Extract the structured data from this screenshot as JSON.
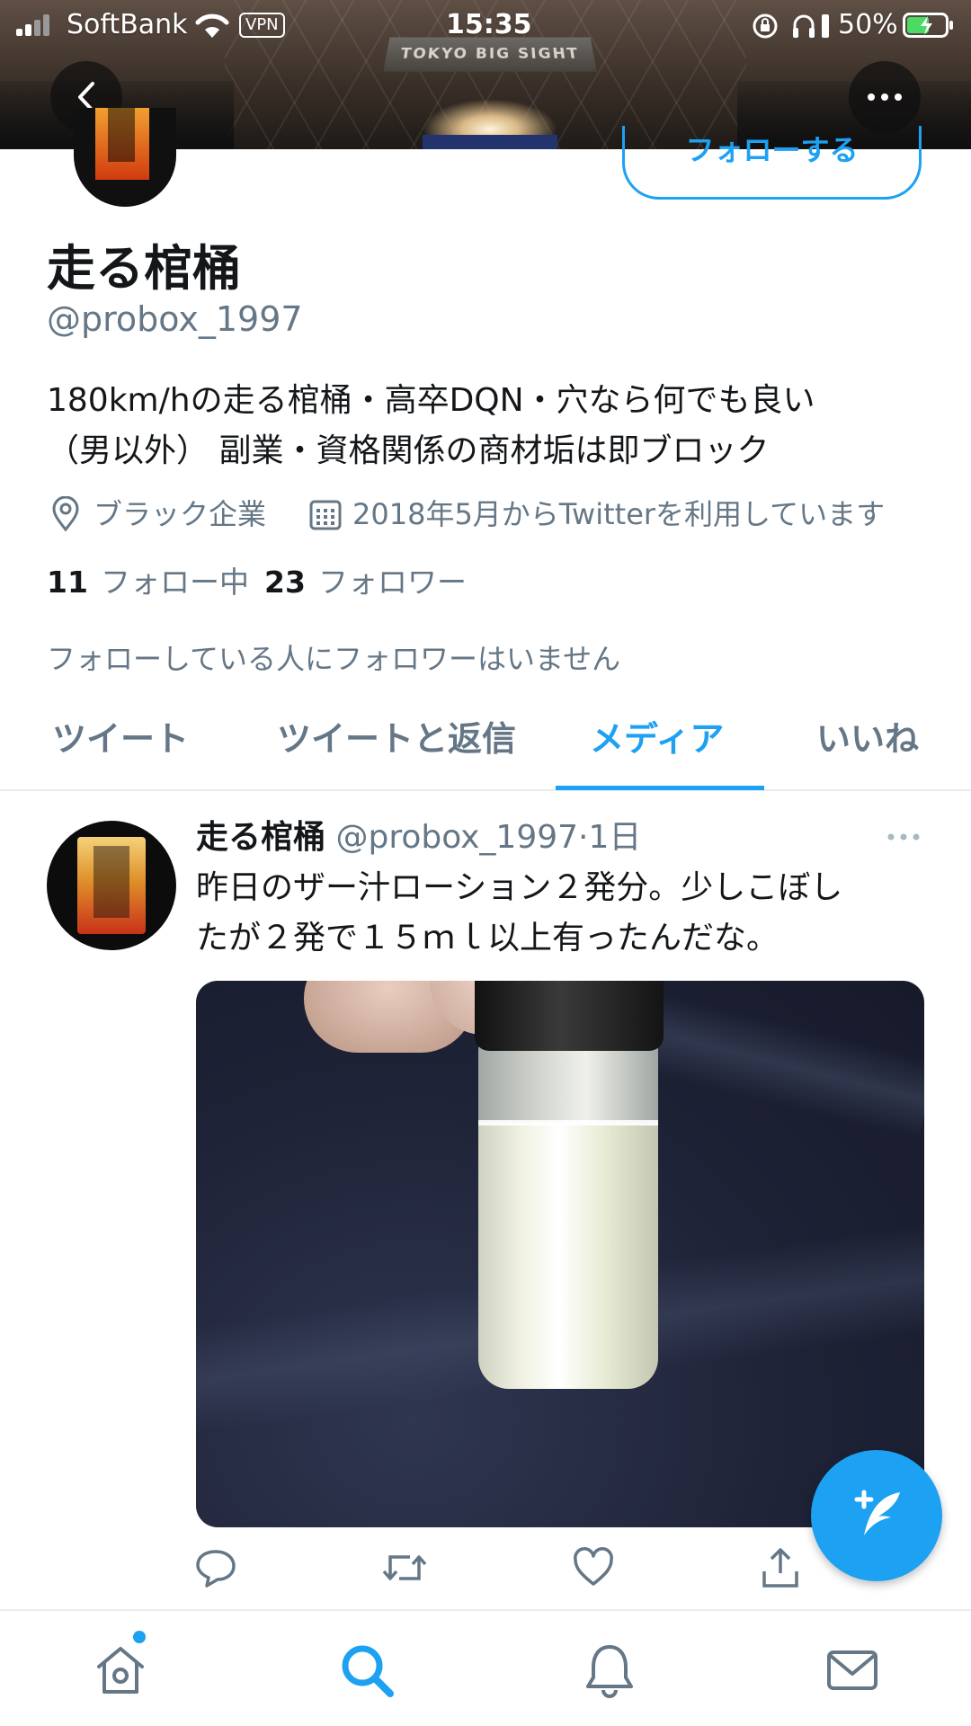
{
  "status_bar": {
    "carrier": "SoftBank",
    "vpn": "VPN",
    "time": "15:35",
    "battery": "50%"
  },
  "banner": {
    "sign_text": "TOKYO BIG SIGHT"
  },
  "profile": {
    "follow_button": "フォローする",
    "name": "走る棺桶",
    "handle": "@probox_1997",
    "bio_line1": "180km/hの走る棺桶・高卒DQN・穴なら何でも良い",
    "bio_line2": "（男以外） 副業・資格関係の商材垢は即ブロック",
    "location": "ブラック企業",
    "joined": "2018年5月からTwitterを利用しています",
    "following_count": "11",
    "following_label": "フォロー中",
    "followers_count": "23",
    "followers_label": "フォロワー",
    "no_followers_note": "フォローしている人にフォロワーはいません"
  },
  "tabs": [
    {
      "label": "ツイート",
      "active": false
    },
    {
      "label": "ツイートと返信",
      "active": false
    },
    {
      "label": "メディア",
      "active": true
    },
    {
      "label": "いいね",
      "active": false
    }
  ],
  "tweet": {
    "name": "走る棺桶",
    "handle": "@probox_1997",
    "separator": "·",
    "time": "1日",
    "text_line1": "昨日のザー汁ローション２発分。少しこぼし",
    "text_line2": "たが２発で１５ｍｌ以上有ったんだな。"
  },
  "icons": {
    "back": "chevron-left-icon",
    "more": "more-dots-icon",
    "location": "location-pin-icon",
    "calendar": "calendar-icon",
    "reply": "reply-icon",
    "retweet": "retweet-icon",
    "like": "heart-icon",
    "share": "share-icon",
    "compose": "compose-tweet-icon",
    "home": "home-icon",
    "search": "search-icon",
    "notifications": "bell-icon",
    "messages": "mail-icon"
  },
  "colors": {
    "accent": "#1da1f2",
    "secondary_text": "#657786",
    "primary_text": "#14171a"
  }
}
